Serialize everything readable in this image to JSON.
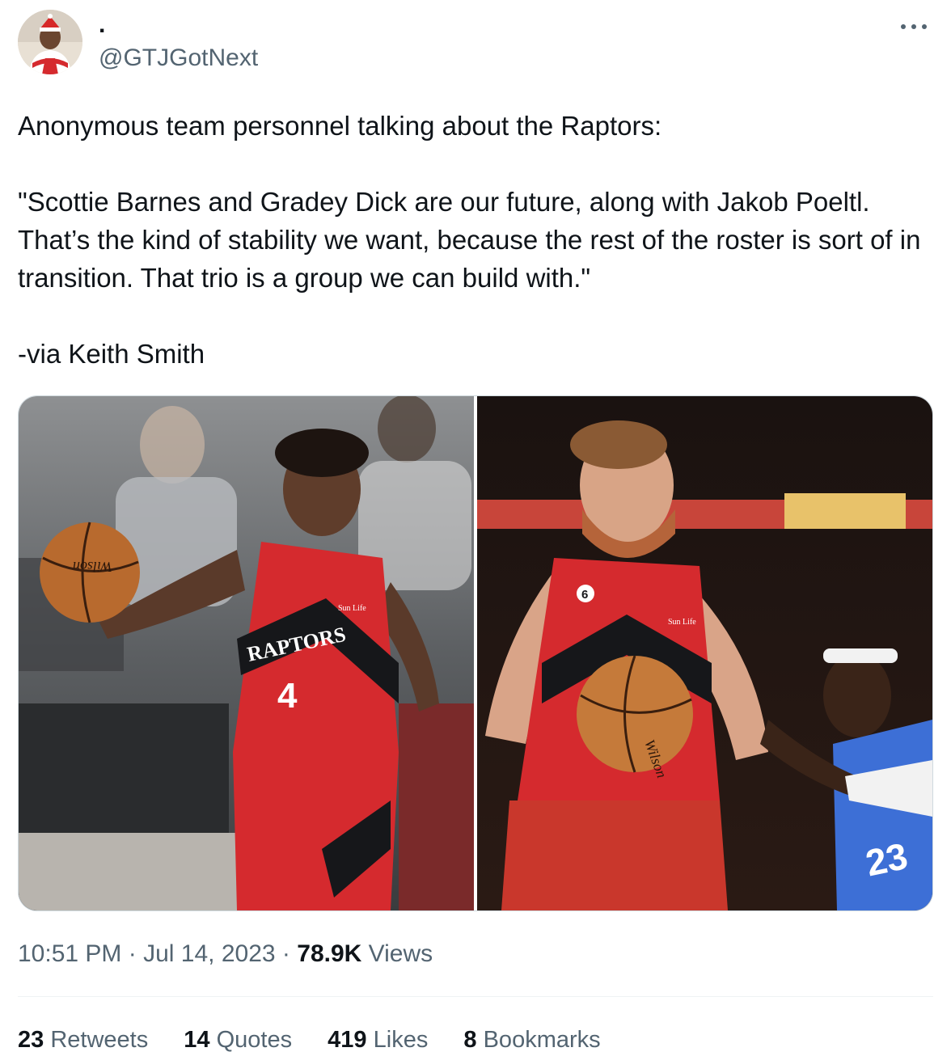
{
  "author": {
    "display_name": ".",
    "handle": "@GTJGotNext",
    "avatar_icon": "avatar-photo"
  },
  "menu_icon": "more-horizontal-icon",
  "tweet": {
    "lines": [
      "Anonymous team personnel talking about the Raptors:",
      "\"Scottie Barnes and Gradey Dick are our future, along with Jakob Poeltl. That’s the kind of stability we want, because the rest of the roster is sort of in transition. That trio is a group we can build with.\"",
      "-via Keith Smith"
    ]
  },
  "media": {
    "left_photo": {
      "jersey_text": "RAPTORS",
      "jersey_number": "4",
      "sponsor": "Sun Life",
      "ball_brand": "Wilson"
    },
    "right_photo": {
      "jersey_badge": "6",
      "sponsor": "Sun Life",
      "opponent_number": "23",
      "ball_brand": "Wilson"
    }
  },
  "meta": {
    "time": "10:51 PM",
    "sep1": "·",
    "date": "Jul 14, 2023",
    "sep2": "·",
    "views_count": "78.9K",
    "views_label": "Views"
  },
  "stats": [
    {
      "count": "23",
      "label": "Retweets"
    },
    {
      "count": "14",
      "label": "Quotes"
    },
    {
      "count": "419",
      "label": "Likes"
    },
    {
      "count": "8",
      "label": "Bookmarks"
    }
  ],
  "colors": {
    "raptors_red": "#d52a2e",
    "text_primary": "#0f1419",
    "text_secondary": "#536471",
    "border": "#cfd9de"
  }
}
